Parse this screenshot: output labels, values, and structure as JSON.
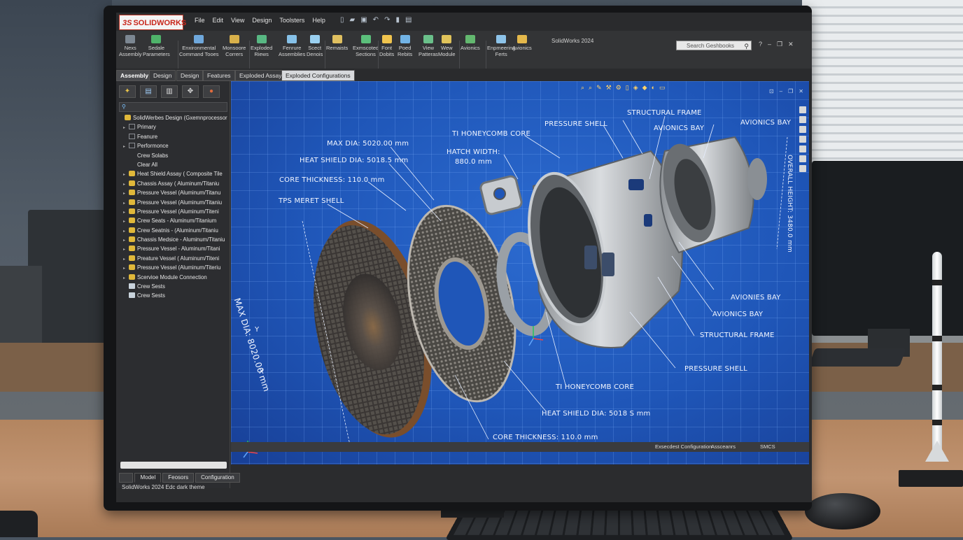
{
  "window": {
    "title": "SolidWorks 2024",
    "logo_text": "SOLIDWORKS",
    "logo_prefix": "3S"
  },
  "menu": [
    "File",
    "Edit",
    "View",
    "Design",
    "Toolsters",
    "Help"
  ],
  "search": {
    "placeholder": "Search Geshbooks"
  },
  "ribbon": [
    {
      "label": "Nexs\nAssembly",
      "icon": "assembly-icon",
      "color": "#7c8792"
    },
    {
      "label": "Sedale\nParameters",
      "icon": "parameters-icon",
      "color": "#4fb36a"
    },
    {
      "label": "Enxironmental\nCommand Tooes",
      "icon": "environment-icon",
      "color": "#6fa8dc"
    },
    {
      "label": "Monsoore\nCorrers",
      "icon": "corners-icon",
      "color": "#d8b04a"
    },
    {
      "label": "Exploded\nRiews",
      "icon": "exploded-icon",
      "color": "#58b883"
    },
    {
      "label": "Fenrure\nAssemblies",
      "icon": "feature-icon",
      "color": "#86c1e8"
    },
    {
      "label": "Scect\nDenois",
      "icon": "sketch-icon",
      "color": "#9ad0f0"
    },
    {
      "label": "Remaists",
      "icon": "remaists-icon",
      "color": "#e0c060"
    },
    {
      "label": "Exmscoted\nSections",
      "icon": "section-icon",
      "color": "#5bbf7b"
    },
    {
      "label": "Font\nDobits",
      "icon": "font-icon",
      "color": "#f0c44e"
    },
    {
      "label": "Poed\nRebits",
      "icon": "rebits-icon",
      "color": "#72b4e6"
    },
    {
      "label": "View\nPatteras",
      "icon": "view-icon",
      "color": "#6ac08a"
    },
    {
      "label": "Wew\nModule",
      "icon": "module-icon",
      "color": "#e0c35a"
    },
    {
      "label": "Avionics",
      "icon": "avionics-icon",
      "color": "#63b86f"
    },
    {
      "label": "Enpmeering\nFerts",
      "icon": "engineering-icon",
      "color": "#8dc3e9"
    },
    {
      "label": "Avionics",
      "icon": "avionics2-icon",
      "color": "#e4b84b"
    }
  ],
  "tabs": [
    "Assembly",
    "Design",
    "Design",
    "Features",
    "Exploded Assay",
    "Exploded Configurations"
  ],
  "tree": [
    {
      "label": "SolidWerbes Design (Gxemnprocessor",
      "icon": "assembly",
      "arrow": ""
    },
    {
      "label": "Primary",
      "icon": "doc",
      "arrow": "▸"
    },
    {
      "label": "Feanure",
      "icon": "doc",
      "arrow": ""
    },
    {
      "label": "Performonce",
      "icon": "doc",
      "arrow": "▸"
    },
    {
      "label": "Crew Solabs",
      "icon": "none",
      "arrow": ""
    },
    {
      "label": "Clear All",
      "icon": "none",
      "arrow": ""
    },
    {
      "label": "Heat Shield Assay ( Composite Tile",
      "icon": "assembly",
      "arrow": "▸"
    },
    {
      "label": "Chassis Assay ( Aluminum/Titaniu",
      "icon": "assembly",
      "arrow": "▸"
    },
    {
      "label": "Pressure Vessel (Aluminum/Titanu",
      "icon": "assembly",
      "arrow": "▸"
    },
    {
      "label": "Pressure Vessel (Aluminum/Titaniu",
      "icon": "assembly",
      "arrow": "▸"
    },
    {
      "label": "Pressure Vessel (Aluminum/Titeni",
      "icon": "assembly",
      "arrow": "▸"
    },
    {
      "label": "Crew Seats - Aluminum/Titanium",
      "icon": "assembly",
      "arrow": "▸"
    },
    {
      "label": "Crew Seatnis - (Aluminum/Titaniu",
      "icon": "assembly",
      "arrow": "▸"
    },
    {
      "label": "Chassis Medsice - Aluminum/Titaniu",
      "icon": "assembly",
      "arrow": "▸"
    },
    {
      "label": "Pressure Vessel - Aluminum/Titani",
      "icon": "assembly",
      "arrow": "▸"
    },
    {
      "label": "Preature Vessel ( Aluminum/Titeni",
      "icon": "assembly",
      "arrow": "▸"
    },
    {
      "label": "Pressure Vessel (Aluminum/Titeriu",
      "icon": "assembly",
      "arrow": "▸"
    },
    {
      "label": "Scervioe Module Connection",
      "icon": "assembly",
      "arrow": "▸"
    },
    {
      "label": "Crew Sests",
      "icon": "part",
      "arrow": ""
    },
    {
      "label": "Crew Sests",
      "icon": "part",
      "arrow": ""
    }
  ],
  "bottom_tabs": [
    "Model",
    "Feosors",
    "Configuration"
  ],
  "status": {
    "left": "SolidWorks 2024 Edc dark theme",
    "config": "Exsecdest Configuration",
    "mode": "Assceanrs",
    "units": "SMCS"
  },
  "callouts": {
    "max_dia": "MAX DIA: 5020.00 mm",
    "heat_shield_dia": "HEAT SHIELD DIA: 5018.5 mm",
    "core_thickness": "CORE THICKNESS: 110.0 mm",
    "tps_shell": "TPS MERET SHELL",
    "ti_core": "TI HONEYCOMB CORE",
    "hatch_width": "HATCH WIDTH:",
    "hatch_value": "880.0 mm",
    "pressure_shell": "PRESSURE SHELL",
    "structural_frame": "STRUCTURAL FRAME",
    "avionics_bay": "AVIONICS BAY",
    "avionics_bay_2": "AVIONICS BAY",
    "avionics_bay_3": "AVIONIES BAY",
    "avionics_bay_4": "AVIONICS BAY",
    "structural_frame_2": "STRUCTURAL FRAME",
    "pressure_shell_2": "PRESSURE SHELL",
    "ti_core_2": "TI HONEYCOMB CORE",
    "heat_shield_dia_2": "HEAT SHIELD DIA: 5018 S mm",
    "core_thickness_2": "CORE THICKNESS: 110.0 mm",
    "max_dia_vertical": "MAX DIA: 8020.00 mm",
    "overall_height": "OVERALL HEIGHT: 3480.0 mm",
    "axis_y": "Y",
    "axis_x": "X"
  }
}
